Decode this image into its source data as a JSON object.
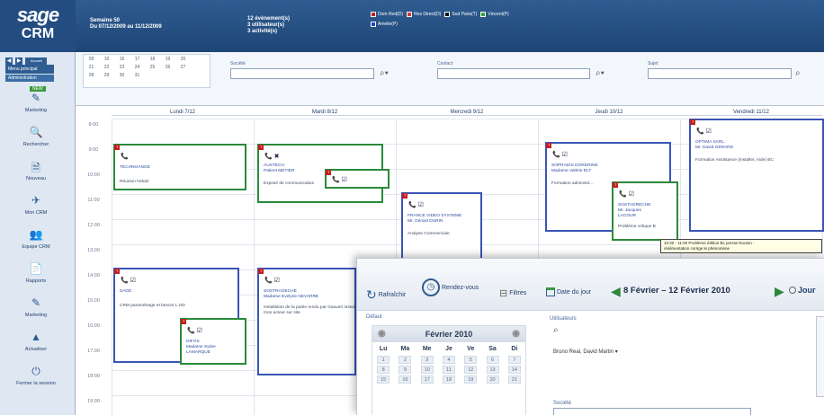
{
  "brand": {
    "line1": "sage",
    "line2": "CRM"
  },
  "header": {
    "week": "Semaine 50",
    "period": "Du 07/12/2009 au 11/12/2009",
    "counts": [
      "12 évènement(s)",
      "3 utilisateur(s)",
      "3 activité(s)"
    ],
    "legend": [
      {
        "label": "Dom Red(D)",
        "color": "#c41e1e"
      },
      {
        "label": "Res Direct(D)",
        "color": "#d03a3a"
      },
      {
        "label": "Sud Paris(T)",
        "color": "#111111"
      },
      {
        "label": "Vincent(P)",
        "color": "#2fa83a"
      },
      {
        "label": "Amelie(P)",
        "color": "#2a3fd0"
      }
    ]
  },
  "sidebar": {
    "top_buttons": [
      "◀",
      "▶",
      "Accueil"
    ],
    "menu_principal": "Menu principal",
    "administration": "Administration",
    "new_badge": "NEW",
    "items": [
      {
        "label": "Marketing",
        "icon": "marketing-icon"
      },
      {
        "label": "Rechercher",
        "icon": "search-icon"
      },
      {
        "label": "Nouveau",
        "icon": "new-document-icon"
      },
      {
        "label": "Mon CRM",
        "icon": "my-crm-icon"
      },
      {
        "label": "Equipe CRM",
        "icon": "team-icon"
      },
      {
        "label": "Rapports",
        "icon": "reports-icon"
      },
      {
        "label": "Marketing",
        "icon": "marketing-icon"
      },
      {
        "label": "Actualiser",
        "icon": "refresh-icon"
      },
      {
        "label": "Fermer la session",
        "icon": "logout-icon"
      }
    ]
  },
  "filters": {
    "mini_calendar_rows": [
      [
        "09",
        "10",
        "16",
        "17",
        "18",
        "19",
        "20"
      ],
      [
        "21",
        "22",
        "23",
        "24",
        "25",
        "26",
        "27"
      ],
      [
        "28",
        "29",
        "30",
        "31",
        "",
        "",
        ""
      ]
    ],
    "fields": [
      {
        "label": "Société"
      },
      {
        "label": "Contact"
      },
      {
        "label": "Sujet"
      }
    ]
  },
  "calendar": {
    "days": [
      "Lundi 7/12",
      "Mardi 8/12",
      "Mercredi 9/12",
      "Jeudi 10/12",
      "Vendredi 11/12"
    ],
    "times": [
      "8:00",
      "9:00",
      "10:00",
      "11:00",
      "12:00",
      "13:00",
      "14:00",
      "15:00",
      "16:00",
      "17:00",
      "18:00",
      "19:00"
    ],
    "events": [
      {
        "tag": "T",
        "lines": [
          "TECHNOANGE"
        ],
        "desc": "Réunion hebdo"
      },
      {
        "tag": "T",
        "lines": [
          "AUSTECH",
          "Patient METIER"
        ],
        "desc": "Exposé de communication"
      },
      {
        "tag": "T",
        "lines": [],
        "desc": ""
      },
      {
        "tag": "T",
        "lines": [
          "FRANCE VIDEO SYSTEME",
          "Mr. Gérard DURIN"
        ],
        "desc": "Analyse Commerciale"
      },
      {
        "tag": "T",
        "lines": [
          "SOPRADIS DORDRINE",
          "Madame Valérie ELT"
        ],
        "desc": "Formation administr..."
      },
      {
        "tag": "T",
        "lines": [
          "SOSTAGRECHE",
          "Mr. Jacques",
          "LACOUR"
        ],
        "desc": "Problème critique B"
      },
      {
        "tag": "T",
        "lines": [
          "OPTIMA SARL",
          "Mr. David GÉRARD"
        ],
        "desc": "Formation Assistance (Installer, Aide) BC"
      },
      {
        "tag": "T",
        "lines": [
          "SAGE"
        ],
        "desc": "CRM paramétrage et besoin L.OD"
      },
      {
        "tag": "T",
        "lines": [
          "INFOS",
          "Madame Sylvie",
          "LAMARQUE"
        ],
        "desc": ""
      },
      {
        "tag": "T",
        "lines": [
          "SOSTRAGECHE",
          "Madame Evelyne NEVARRE"
        ],
        "desc": "Installation de la partie rendu par Gauvert install mon acteur sur site"
      }
    ],
    "tooltip": [
      "10:30 - 11:00 Problème édition BL presse-bouton -",
      "réalimentation corrige le phénomène"
    ]
  },
  "overlay": {
    "toolbar": [
      {
        "label": "Rafraîchir",
        "icon": "refresh-icon"
      },
      {
        "label": "Rendez-vous",
        "icon": "appointment-icon"
      },
      {
        "label": "Filtres",
        "icon": "filter-icon"
      },
      {
        "label": "Date du jour",
        "icon": "today-icon"
      }
    ],
    "range": "8 Février – 12 Février 2010",
    "view_label": "Jour",
    "section_label": "Défaut",
    "calendar_month": "Février 2010",
    "weekdays": [
      "Lu",
      "Ma",
      "Me",
      "Je",
      "Ve",
      "Sa",
      "Di"
    ],
    "weeks": [
      [
        "1",
        "2",
        "3",
        "4",
        "5",
        "6",
        "7"
      ],
      [
        "8",
        "9",
        "10",
        "11",
        "12",
        "13",
        "14"
      ],
      [
        "15",
        "16",
        "17",
        "18",
        "19",
        "20",
        "21"
      ]
    ],
    "users_label": "Utilisateurs",
    "users_value": "Bruno Real, David Martin",
    "societe_label": "Société"
  }
}
